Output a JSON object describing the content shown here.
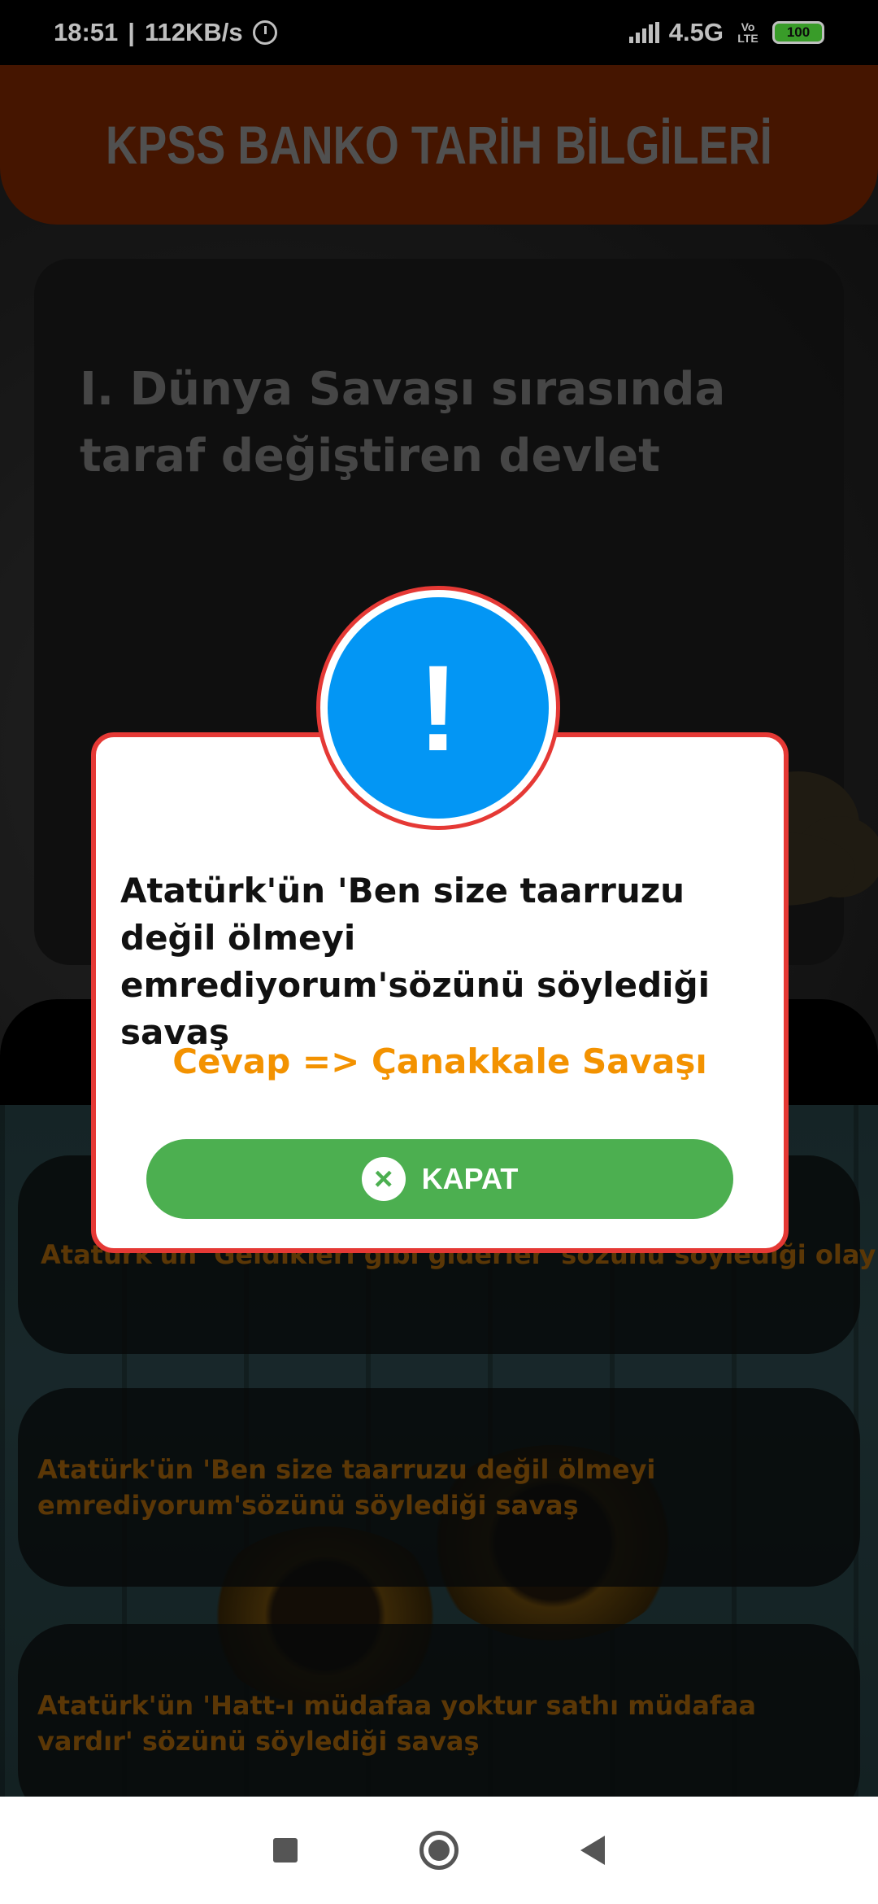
{
  "status_bar": {
    "time": "18:51",
    "separator": "|",
    "speed": "112KB/s",
    "network": "4.5G",
    "volte": "Vo LTE",
    "battery": "100"
  },
  "app_bar": {
    "title": "KPSS BANKO TARİH BİLGİLERİ"
  },
  "question_card": {
    "text": "I. Dünya Savaşı sırasında taraf değiştiren devlet"
  },
  "list_items": [
    {
      "label": "Atatürk'ün 'Geldikleri gibi giderler' sözünü söylediği olay"
    },
    {
      "label": "Atatürk'ün 'Ben size taarruzu değil ölmeyi emrediyorum'sözünü söylediği savaş"
    },
    {
      "label": "Atatürk'ün 'Hatt-ı müdafaa yoktur sathı müdafaa vardır' sözünü söylediği savaş"
    }
  ],
  "dialog": {
    "icon": "exclamation-icon",
    "icon_glyph": "!",
    "message": "Atatürk'ün 'Ben size taarruzu değil ölmeyi emrediyorum'sözünü söylediği savaş",
    "answer": "Cevap => Çanakkale Savaşı",
    "close_icon": "×",
    "close_label": "KAPAT",
    "accent_border": "#e53935",
    "icon_color": "#0396f4",
    "answer_color": "#f39200",
    "button_color": "#4caf50"
  },
  "nav_bar": {
    "recents": "recents-square-icon",
    "home": "home-circle-icon",
    "back": "back-triangle-icon"
  }
}
